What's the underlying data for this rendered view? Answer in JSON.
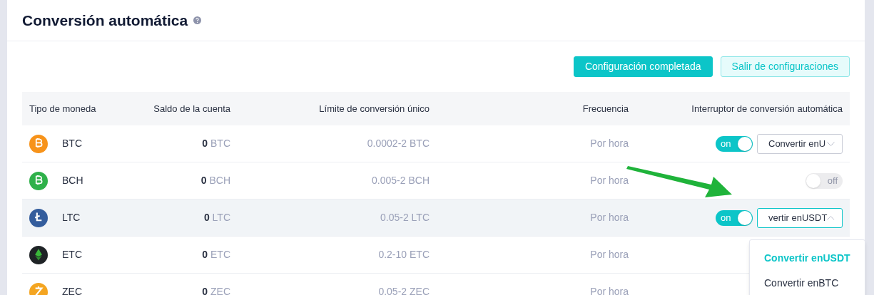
{
  "page": {
    "title": "Conversión automática"
  },
  "actions": [
    {
      "label": "Configuración completada",
      "kind": "primary"
    },
    {
      "label": "Salir de configuraciones",
      "kind": "secondary"
    }
  ],
  "table": {
    "columns": [
      "Tipo de moneda",
      "Saldo de la cuenta",
      "Límite de conversión único",
      "Frecuencia",
      "Interruptor de conversión automática"
    ],
    "rows": [
      {
        "coin": "BTC",
        "kind": "bitcoin",
        "color": "#f7931a",
        "balance": "0",
        "unit": "BTC",
        "limit": "0.0002-2 BTC",
        "frequency": "Por hora",
        "selected": false,
        "switch": {
          "on": true,
          "label": "on"
        },
        "select": {
          "value": "Convertir enU",
          "expanded": false
        }
      },
      {
        "coin": "BCH",
        "kind": "bitcoin",
        "color": "#2fb14a",
        "balance": "0",
        "unit": "BCH",
        "limit": "0.005-2 BCH",
        "frequency": "Por hora",
        "selected": false,
        "switch": {
          "on": false,
          "label": "off"
        }
      },
      {
        "coin": "LTC",
        "kind": "litecoin",
        "color": "#345d9d",
        "balance": "0",
        "unit": "LTC",
        "limit": "0.05-2 LTC",
        "frequency": "Por hora",
        "selected": true,
        "switch": {
          "on": true,
          "label": "on"
        },
        "select": {
          "value": "vertir enUSDT",
          "expanded": true,
          "options": [
            {
              "label": "Convertir enUSDT",
              "selected": true
            },
            {
              "label": "Convertir enBTC",
              "selected": false
            }
          ]
        }
      },
      {
        "coin": "ETC",
        "kind": "ethereum",
        "color": "#1f2326",
        "balance": "0",
        "unit": "ETC",
        "limit": "0.2-10 ETC",
        "frequency": "Por hora",
        "selected": false,
        "switch": null
      },
      {
        "coin": "ZEC",
        "kind": "zcash",
        "color": "#f4a521",
        "balance": "0",
        "unit": "ZEC",
        "limit": "0.05-2 ZEC",
        "frequency": "Por hora",
        "selected": false,
        "switch": null
      }
    ]
  }
}
